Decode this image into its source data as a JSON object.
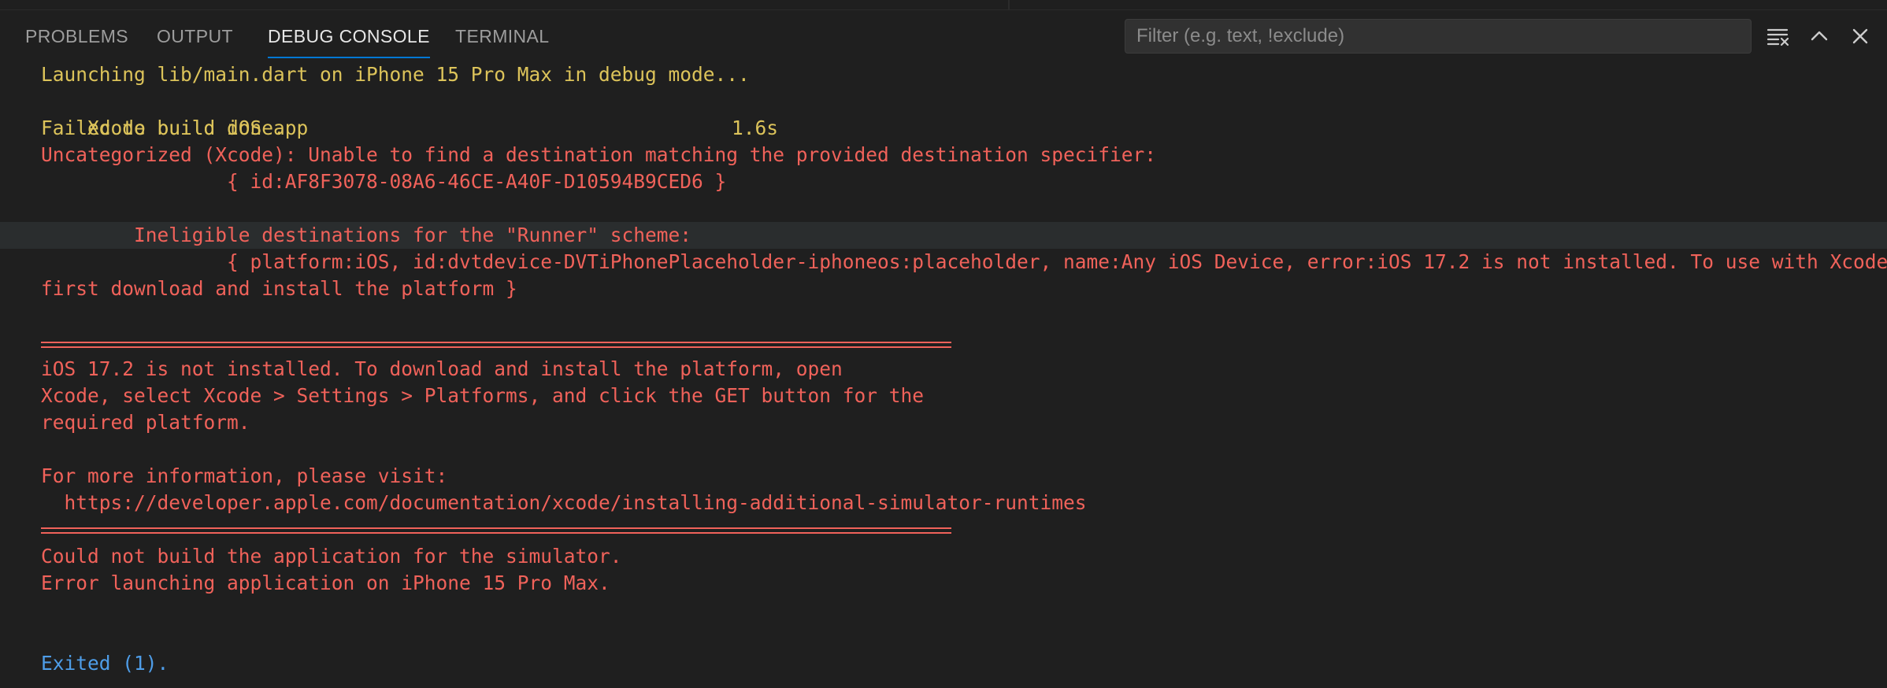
{
  "tabs": [
    {
      "label": "PROBLEMS"
    },
    {
      "label": "OUTPUT"
    },
    {
      "label": "DEBUG CONSOLE",
      "active": true
    },
    {
      "label": "TERMINAL"
    }
  ],
  "filter": {
    "placeholder": "Filter (e.g. text, !exclude)",
    "value": ""
  },
  "toolbar": {
    "icons": [
      "clear-console-icon",
      "chevron-up-icon",
      "close-icon"
    ]
  },
  "colors": {
    "yellow": "#dcc35a",
    "red": "#f0625a",
    "blue": "#4e9de8",
    "accent": "#0078d4"
  },
  "console": {
    "line1": "Launching lib/main.dart on iPhone 15 Pro Max in debug mode...",
    "line2_text": "Xcode build done.",
    "line2_time": "1.6s",
    "line3": "Failed to build iOS app",
    "line4": "Uncategorized (Xcode): Unable to find a destination matching the provided destination specifier:",
    "line5": "                { id:AF8F3078-08A6-46CE-A40F-D10594B9CED6 }",
    "line6": "        Ineligible destinations for the \"Runner\" scheme:",
    "line7": "                { platform:iOS, id:dvtdevice-DVTiPhonePlaceholder-iphoneos:placeholder, name:Any iOS Device, error:iOS 17.2 is not installed. To use with Xcode,",
    "line8": "first download and install the platform }",
    "line9": "iOS 17.2 is not installed. To download and install the platform, open",
    "line10": "Xcode, select Xcode > Settings > Platforms, and click the GET button for the",
    "line11": "required platform.",
    "line12": "For more information, please visit:",
    "line13": "  https://developer.apple.com/documentation/xcode/installing-additional-simulator-runtimes",
    "line14": "Could not build the application for the simulator.",
    "line15": "Error launching application on iPhone 15 Pro Max.",
    "line16": "Exited (1)."
  }
}
